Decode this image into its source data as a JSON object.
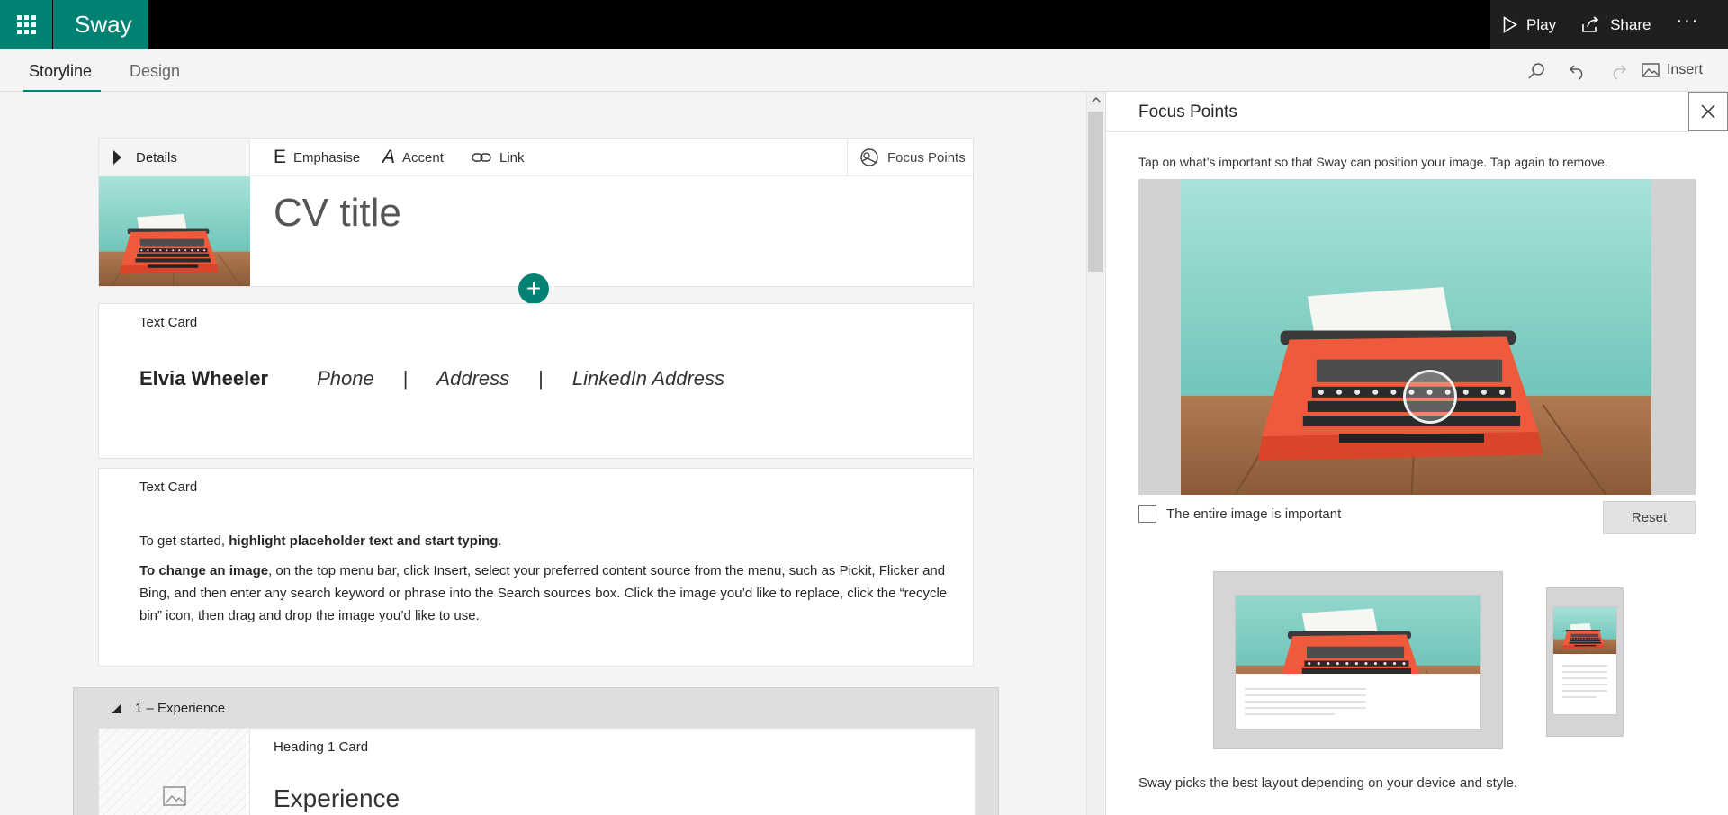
{
  "app": {
    "name": "Sway"
  },
  "topbar": {
    "play": "Play",
    "share": "Share",
    "more": "···"
  },
  "tabs": [
    {
      "label": "Storyline"
    },
    {
      "label": "Design"
    }
  ],
  "toolbar": {
    "insert": "Insert"
  },
  "title_card": {
    "details": "Details",
    "emphasise": "Emphasise",
    "accent": "Accent",
    "link": "Link",
    "focus_points": "Focus Points",
    "title": "CV title"
  },
  "contact_card": {
    "label": "Text Card",
    "name": "Elvia Wheeler",
    "phone": "Phone",
    "separator": "|",
    "address": "Address",
    "linkedin": "LinkedIn Address"
  },
  "text_card": {
    "label": "Text Card",
    "p1_prefix": "To get started, ",
    "p1_bold": "highlight placeholder text and start typing",
    "p1_suffix": ".",
    "p2_bold": "To change an image",
    "p2_rest": ", on the top menu bar, click Insert, select your preferred content source from the menu, such as Pickit, Flicker and Bing, and then enter any search keyword or phrase into the Search sources box. Click the image you’d like to replace, click the “recycle bin” icon, then drag and drop the image you’d like to use."
  },
  "section": {
    "header": "1 – Experience",
    "card_label": "Heading 1 Card",
    "heading": "Experience"
  },
  "focus_panel": {
    "title": "Focus Points",
    "help": "Tap on what’s important so that Sway can position your image. Tap again to remove.",
    "checkbox_label": "The entire image is important",
    "reset": "Reset",
    "footer": "Sway picks the best layout depending on your device and style."
  },
  "colors": {
    "accent": "#008272",
    "topbar": "#000000",
    "typewriter": "#f05a3c",
    "wall": "#7fd0c4"
  },
  "icons": [
    "waffle-icon",
    "play-icon",
    "share-icon",
    "search-icon",
    "undo-icon",
    "redo-icon",
    "image-icon",
    "focus-points-icon",
    "close-icon",
    "link-icon",
    "plus-icon"
  ]
}
